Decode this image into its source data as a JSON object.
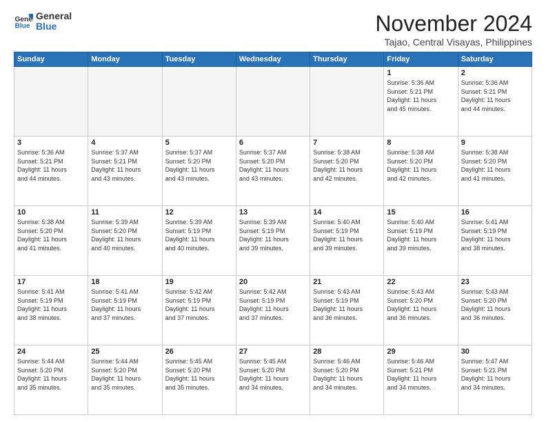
{
  "logo": {
    "line1": "General",
    "line2": "Blue"
  },
  "title": "November 2024",
  "subtitle": "Tajao, Central Visayas, Philippines",
  "days_header": [
    "Sunday",
    "Monday",
    "Tuesday",
    "Wednesday",
    "Thursday",
    "Friday",
    "Saturday"
  ],
  "weeks": [
    [
      {
        "day": "",
        "info": ""
      },
      {
        "day": "",
        "info": ""
      },
      {
        "day": "",
        "info": ""
      },
      {
        "day": "",
        "info": ""
      },
      {
        "day": "",
        "info": ""
      },
      {
        "day": "1",
        "info": "Sunrise: 5:36 AM\nSunset: 5:21 PM\nDaylight: 11 hours\nand 45 minutes."
      },
      {
        "day": "2",
        "info": "Sunrise: 5:36 AM\nSunset: 5:21 PM\nDaylight: 11 hours\nand 44 minutes."
      }
    ],
    [
      {
        "day": "3",
        "info": "Sunrise: 5:36 AM\nSunset: 5:21 PM\nDaylight: 11 hours\nand 44 minutes."
      },
      {
        "day": "4",
        "info": "Sunrise: 5:37 AM\nSunset: 5:21 PM\nDaylight: 11 hours\nand 43 minutes."
      },
      {
        "day": "5",
        "info": "Sunrise: 5:37 AM\nSunset: 5:20 PM\nDaylight: 11 hours\nand 43 minutes."
      },
      {
        "day": "6",
        "info": "Sunrise: 5:37 AM\nSunset: 5:20 PM\nDaylight: 11 hours\nand 43 minutes."
      },
      {
        "day": "7",
        "info": "Sunrise: 5:38 AM\nSunset: 5:20 PM\nDaylight: 11 hours\nand 42 minutes."
      },
      {
        "day": "8",
        "info": "Sunrise: 5:38 AM\nSunset: 5:20 PM\nDaylight: 11 hours\nand 42 minutes."
      },
      {
        "day": "9",
        "info": "Sunrise: 5:38 AM\nSunset: 5:20 PM\nDaylight: 11 hours\nand 41 minutes."
      }
    ],
    [
      {
        "day": "10",
        "info": "Sunrise: 5:38 AM\nSunset: 5:20 PM\nDaylight: 11 hours\nand 41 minutes."
      },
      {
        "day": "11",
        "info": "Sunrise: 5:39 AM\nSunset: 5:20 PM\nDaylight: 11 hours\nand 40 minutes."
      },
      {
        "day": "12",
        "info": "Sunrise: 5:39 AM\nSunset: 5:19 PM\nDaylight: 11 hours\nand 40 minutes."
      },
      {
        "day": "13",
        "info": "Sunrise: 5:39 AM\nSunset: 5:19 PM\nDaylight: 11 hours\nand 39 minutes."
      },
      {
        "day": "14",
        "info": "Sunrise: 5:40 AM\nSunset: 5:19 PM\nDaylight: 11 hours\nand 39 minutes."
      },
      {
        "day": "15",
        "info": "Sunrise: 5:40 AM\nSunset: 5:19 PM\nDaylight: 11 hours\nand 39 minutes."
      },
      {
        "day": "16",
        "info": "Sunrise: 5:41 AM\nSunset: 5:19 PM\nDaylight: 11 hours\nand 38 minutes."
      }
    ],
    [
      {
        "day": "17",
        "info": "Sunrise: 5:41 AM\nSunset: 5:19 PM\nDaylight: 11 hours\nand 38 minutes."
      },
      {
        "day": "18",
        "info": "Sunrise: 5:41 AM\nSunset: 5:19 PM\nDaylight: 11 hours\nand 37 minutes."
      },
      {
        "day": "19",
        "info": "Sunrise: 5:42 AM\nSunset: 5:19 PM\nDaylight: 11 hours\nand 37 minutes."
      },
      {
        "day": "20",
        "info": "Sunrise: 5:42 AM\nSunset: 5:19 PM\nDaylight: 11 hours\nand 37 minutes."
      },
      {
        "day": "21",
        "info": "Sunrise: 5:43 AM\nSunset: 5:19 PM\nDaylight: 11 hours\nand 36 minutes."
      },
      {
        "day": "22",
        "info": "Sunrise: 5:43 AM\nSunset: 5:20 PM\nDaylight: 11 hours\nand 36 minutes."
      },
      {
        "day": "23",
        "info": "Sunrise: 5:43 AM\nSunset: 5:20 PM\nDaylight: 11 hours\nand 36 minutes."
      }
    ],
    [
      {
        "day": "24",
        "info": "Sunrise: 5:44 AM\nSunset: 5:20 PM\nDaylight: 11 hours\nand 35 minutes."
      },
      {
        "day": "25",
        "info": "Sunrise: 5:44 AM\nSunset: 5:20 PM\nDaylight: 11 hours\nand 35 minutes."
      },
      {
        "day": "26",
        "info": "Sunrise: 5:45 AM\nSunset: 5:20 PM\nDaylight: 11 hours\nand 35 minutes."
      },
      {
        "day": "27",
        "info": "Sunrise: 5:45 AM\nSunset: 5:20 PM\nDaylight: 11 hours\nand 34 minutes."
      },
      {
        "day": "28",
        "info": "Sunrise: 5:46 AM\nSunset: 5:20 PM\nDaylight: 11 hours\nand 34 minutes."
      },
      {
        "day": "29",
        "info": "Sunrise: 5:46 AM\nSunset: 5:21 PM\nDaylight: 11 hours\nand 34 minutes."
      },
      {
        "day": "30",
        "info": "Sunrise: 5:47 AM\nSunset: 5:21 PM\nDaylight: 11 hours\nand 34 minutes."
      }
    ]
  ]
}
